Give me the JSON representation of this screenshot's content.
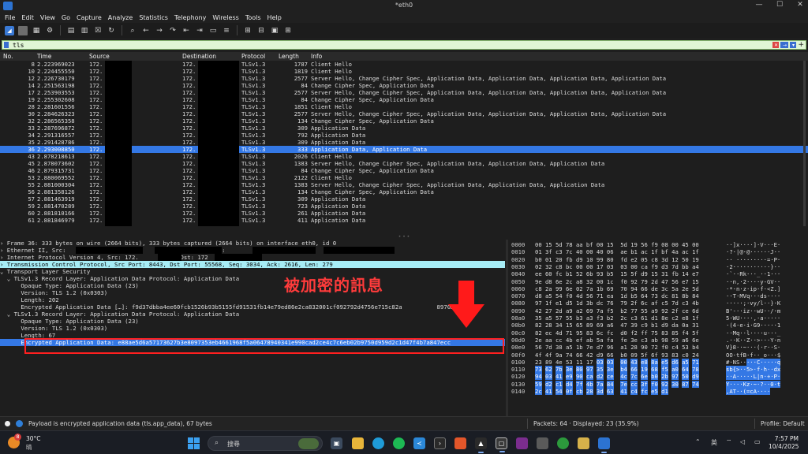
{
  "window": {
    "title": "*eth0",
    "min": "—",
    "max": "☐",
    "close": "✕"
  },
  "menu": [
    "File",
    "Edit",
    "View",
    "Go",
    "Capture",
    "Analyze",
    "Statistics",
    "Telephony",
    "Wireless",
    "Tools",
    "Help"
  ],
  "filter": {
    "value": "tls"
  },
  "columns": {
    "no": "No.",
    "time": "Time",
    "source": "Source",
    "destination": "Destination",
    "protocol": "Protocol",
    "length": "Length",
    "info": "Info"
  },
  "packets": [
    {
      "no": "8",
      "time": "2.223969023",
      "src": "172.",
      "dst": "172.",
      "proto": "TLSv1.3",
      "len": "1787",
      "info": "Client Hello"
    },
    {
      "no": "10",
      "time": "2.224455550",
      "src": "172.",
      "dst": "172.",
      "proto": "TLSv1.3",
      "len": "1819",
      "info": "Client Hello"
    },
    {
      "no": "12",
      "time": "2.226730179",
      "src": "172.",
      "dst": "172.",
      "proto": "TLSv1.3",
      "len": "2577",
      "info": "Server Hello, Change Cipher Spec, Application Data, Application Data, Application Data, Application Data"
    },
    {
      "no": "14",
      "time": "2.251563198",
      "src": "172.",
      "dst": "172.",
      "proto": "TLSv1.3",
      "len": "84",
      "info": "Change Cipher Spec, Application Data"
    },
    {
      "no": "17",
      "time": "2.253903553",
      "src": "172.",
      "dst": "172.",
      "proto": "TLSv1.3",
      "len": "2577",
      "info": "Server Hello, Change Cipher Spec, Application Data, Application Data, Application Data, Application Data"
    },
    {
      "no": "19",
      "time": "2.255302608",
      "src": "172.",
      "dst": "172.",
      "proto": "TLSv1.3",
      "len": "84",
      "info": "Change Cipher Spec, Application Data"
    },
    {
      "no": "28",
      "time": "2.281601556",
      "src": "172.",
      "dst": "172.",
      "proto": "TLSv1.3",
      "len": "1851",
      "info": "Client Hello"
    },
    {
      "no": "30",
      "time": "2.284626323",
      "src": "172.",
      "dst": "172.",
      "proto": "TLSv1.3",
      "len": "2577",
      "info": "Server Hello, Change Cipher Spec, Application Data, Application Data, Application Data, Application Data"
    },
    {
      "no": "32",
      "time": "2.286565358",
      "src": "172.",
      "dst": "172.",
      "proto": "TLSv1.3",
      "len": "134",
      "info": "Change Cipher Spec, Application Data"
    },
    {
      "no": "33",
      "time": "2.287696872",
      "src": "172.",
      "dst": "172.",
      "proto": "TLSv1.3",
      "len": "309",
      "info": "Application Data"
    },
    {
      "no": "34",
      "time": "2.291316557",
      "src": "172.",
      "dst": "172.",
      "proto": "TLSv1.3",
      "len": "792",
      "info": "Application Data"
    },
    {
      "no": "35",
      "time": "2.291428786",
      "src": "172.",
      "dst": "172.",
      "proto": "TLSv1.3",
      "len": "309",
      "info": "Application Data"
    },
    {
      "no": "36",
      "time": "2.293008850",
      "src": "172.",
      "dst": "172.",
      "proto": "TLSv1.3",
      "len": "333",
      "info": "Application Data, Application Data",
      "selected": true
    },
    {
      "no": "43",
      "time": "2.878218613",
      "src": "172.",
      "dst": "172.",
      "proto": "TLSv1.3",
      "len": "2026",
      "info": "Client Hello"
    },
    {
      "no": "45",
      "time": "2.878073602",
      "src": "172.",
      "dst": "172.",
      "proto": "TLSv1.3",
      "len": "1383",
      "info": "Server Hello, Change Cipher Spec, Application Data, Application Data, Application Data"
    },
    {
      "no": "46",
      "time": "2.879315731",
      "src": "172.",
      "dst": "172.",
      "proto": "TLSv1.3",
      "len": "84",
      "info": "Change Cipher Spec, Application Data"
    },
    {
      "no": "53",
      "time": "2.880069552",
      "src": "172.",
      "dst": "172.",
      "proto": "TLSv1.3",
      "len": "2122",
      "info": "Client Hello"
    },
    {
      "no": "55",
      "time": "2.881000304",
      "src": "172.",
      "dst": "172.",
      "proto": "TLSv1.3",
      "len": "1383",
      "info": "Server Hello, Change Cipher Spec, Application Data, Application Data, Application Data"
    },
    {
      "no": "56",
      "time": "2.881358126",
      "src": "172.",
      "dst": "172.",
      "proto": "TLSv1.3",
      "len": "134",
      "info": "Change Cipher Spec, Application Data"
    },
    {
      "no": "57",
      "time": "2.881463919",
      "src": "172.",
      "dst": "172.",
      "proto": "TLSv1.3",
      "len": "309",
      "info": "Application Data"
    },
    {
      "no": "59",
      "time": "2.881470289",
      "src": "172.",
      "dst": "172.",
      "proto": "TLSv1.3",
      "len": "723",
      "info": "Application Data"
    },
    {
      "no": "60",
      "time": "2.881810166",
      "src": "172.",
      "dst": "172.",
      "proto": "TLSv1.3",
      "len": "261",
      "info": "Application Data"
    },
    {
      "no": "61",
      "time": "2.881846979",
      "src": "172.",
      "dst": "172.",
      "proto": "TLSv1.3",
      "len": "411",
      "info": "Application Data"
    }
  ],
  "details": [
    {
      "text": "› Frame 36: 333 bytes on wire (2664 bits), 333 bytes captured (2664 bits) on interface eth0, id 0",
      "style": ""
    },
    {
      "text": "› Ethernet II, Src:                   (                   ), Dst:                   (                   )",
      "style": "",
      "redact": [
        "d1",
        "d2",
        "d3",
        "d4"
      ]
    },
    {
      "text": "› Internet Protocol Version 4, Src: 172.         4, Dst: 172",
      "style": "",
      "redact": [
        "d5",
        "d6"
      ]
    },
    {
      "text": "› Transmission Control Protocol, Src Port: 8443, Dst Port: 55568, Seq: 3034, Ack: 2616, Len: 279",
      "style": "tcp"
    },
    {
      "text": "⌄ Transport Layer Security",
      "style": ""
    },
    {
      "text": "  ⌄ TLSv1.3 Record Layer: Application Data Protocol: Application Data",
      "style": ""
    },
    {
      "text": "      Opaque Type: Application Data (23)",
      "style": ""
    },
    {
      "text": "      Version: TLS 1.2 (0x0303)",
      "style": ""
    },
    {
      "text": "      Length: 202",
      "style": ""
    },
    {
      "text": "      Encrypted Application Data […]: f9d37dbba4ee60fcb1526b93b5155fd91531fb14e79ed86e2ca832001cf092792d4756e715c82a          8970…",
      "style": ""
    },
    {
      "text": "  ⌄ TLSv1.3 Record Layer: Application Data Protocol: Application Data",
      "style": ""
    },
    {
      "text": "      Opaque Type: Application Data (23)",
      "style": ""
    },
    {
      "text": "      Version: TLS 1.2 (0x0303)",
      "style": ""
    },
    {
      "text": "      Length: 67",
      "style": ""
    },
    {
      "text": "      Encrypted Application Data: e88ae5d6a57173627b3e8097353eb4661968f5a06478940341e990cad2ce4c7c6eb02b9750d959d2c1d47f4b7a847ecc",
      "style": "sel"
    }
  ],
  "annotation": {
    "text": "被加密的訊息"
  },
  "hex": [
    {
      "off": "0000",
      "bytes": "00 15 5d 78 aa bf 00 15  5d 19 56 f9 08 00 45 00",
      "ascii": "··]x····]·V···E·",
      "hl": 0
    },
    {
      "off": "0010",
      "bytes": "01 3f c3 7c 40 00 40 06  ae b1 ac 1f bf 4a ac 1f",
      "ascii": "·?·|@·@······J··",
      "hl": 0
    },
    {
      "off": "0020",
      "bytes": "b0 01 20 fb d9 10 99 80  fd e2 05 c8 3d 12 50 19",
      "ascii": "·· ·········=·P·",
      "hl": 0
    },
    {
      "off": "0030",
      "bytes": "02 32 c8 bc 00 00 17 03  03 00 ca f9 d3 7d bb a4",
      "ascii": "·2···········}··",
      "hl": 0
    },
    {
      "off": "0040",
      "bytes": "ee 60 fc b1 52 6b 93 b5  15 5f d9 15 31 fb 14 e7",
      "ascii": "·`··Rk···_··1···",
      "hl": 0
    },
    {
      "off": "0050",
      "bytes": "9e d8 6e 2c a8 32 00 1c  f0 92 79 2d 47 56 e7 15",
      "ascii": "··n,·2····y-GV··",
      "hl": 0
    },
    {
      "off": "0060",
      "bytes": "c8 2a 99 6e 02 7a 1b 69  70 94 66 de 3c 5a 2e 5d",
      "ascii": "·*·n·z·ip·f·<Z.]",
      "hl": 0
    },
    {
      "off": "0070",
      "bytes": "d8 a5 54 f0 4d 56 71 ea  1d b5 64 73 dc 81 8b 84",
      "ascii": "··T·MVq···ds····",
      "hl": 0
    },
    {
      "off": "0080",
      "bytes": "97 1f e1 d5 1d 3b dc 76  79 2f 6c af c5 7d c3 4b",
      "ascii": "·····;·vy/l··}·K",
      "hl": 0
    },
    {
      "off": "0090",
      "bytes": "42 27 2d a9 a2 69 7a f5  b2 77 55 a9 92 2f ce 6d",
      "ascii": "B'-··iz··wU··/·m",
      "hl": 0
    },
    {
      "off": "00a0",
      "bytes": "35 a5 57 55 b3 a3 f3 b2  2c c3 61 d1 8e c2 e8 1f",
      "ascii": "5·WU····,·a·····",
      "hl": 0
    },
    {
      "off": "00b0",
      "bytes": "82 28 34 15 65 89 69 a6  47 39 c9 b1 d9 da 0a 31",
      "ascii": "·(4·e·i·G9·····1",
      "hl": 0
    },
    {
      "off": "00c0",
      "bytes": "82 ec 4d 71 95 83 6c fc  d0 f2 ff 75 83 85 f4 5f",
      "ascii": "··Mq··l····u···_",
      "hl": 0
    },
    {
      "off": "00d0",
      "bytes": "2e aa cc 4b ef ab 5a fa  fe 3e c3 ab 98 59 a6 6e",
      "ascii": ".··K··Z··>···Y·n",
      "hl": 0
    },
    {
      "off": "00e0",
      "bytes": "56 7d 38 a5 1b 7e d7 96  a1 28 90 72 f0 c4 53 b4",
      "ascii": "V}8··~···(·r··S·",
      "hl": 0
    },
    {
      "off": "00f0",
      "bytes": "4f 4f 9a 74 66 42 d9 66  b0 09 5f 6f 93 83 c0 24",
      "ascii": "OO·tfB·f··_o···$",
      "hl": 0
    },
    {
      "off": "0100",
      "bytes": "23 89 4e 53 11 17 03 03  00 43 e8 8a e5 d6 a5 71",
      "ascii": "#·NS·····C·····q",
      "hl": 10
    },
    {
      "off": "0110",
      "bytes": "73 62 7b 3e 80 97 35 3e  b4 66 19 68 f5 a0 64 78",
      "ascii": "sb{>··5>·f·h··dx",
      "hl": 16
    },
    {
      "off": "0120",
      "bytes": "94 03 41 e9 90 ca d2 ce  4c 7c 6e b0 2b 97 50 d9",
      "ascii": "··A·····L|n·+·P·",
      "hl": 16
    },
    {
      "off": "0130",
      "bytes": "59 d2 c1 d4 7f 4b 7a 84  7e cc 3f f0 92 30 87 74",
      "ascii": "Y····Kz·~·?··0·t",
      "hl": 16
    },
    {
      "off": "0140",
      "bytes": "2c 41 54 0f cb 28 3d 63  41 c4 fc e5 d1",
      "ascii": ",AT··(=cA····",
      "hl": 13
    }
  ],
  "status": {
    "text": "Payload is encrypted application data (tls.app_data), 67 bytes",
    "packets": "Packets: 64 · Displayed: 23 (35.9%)",
    "profile": "Profile: Default"
  },
  "taskbar": {
    "weather_temp": "30°C",
    "weather_desc": "晴",
    "weather_badge": "8",
    "search_placeholder": "搜尋",
    "ime": "英",
    "time": "7:57 PM",
    "date": "10/4/2025"
  }
}
